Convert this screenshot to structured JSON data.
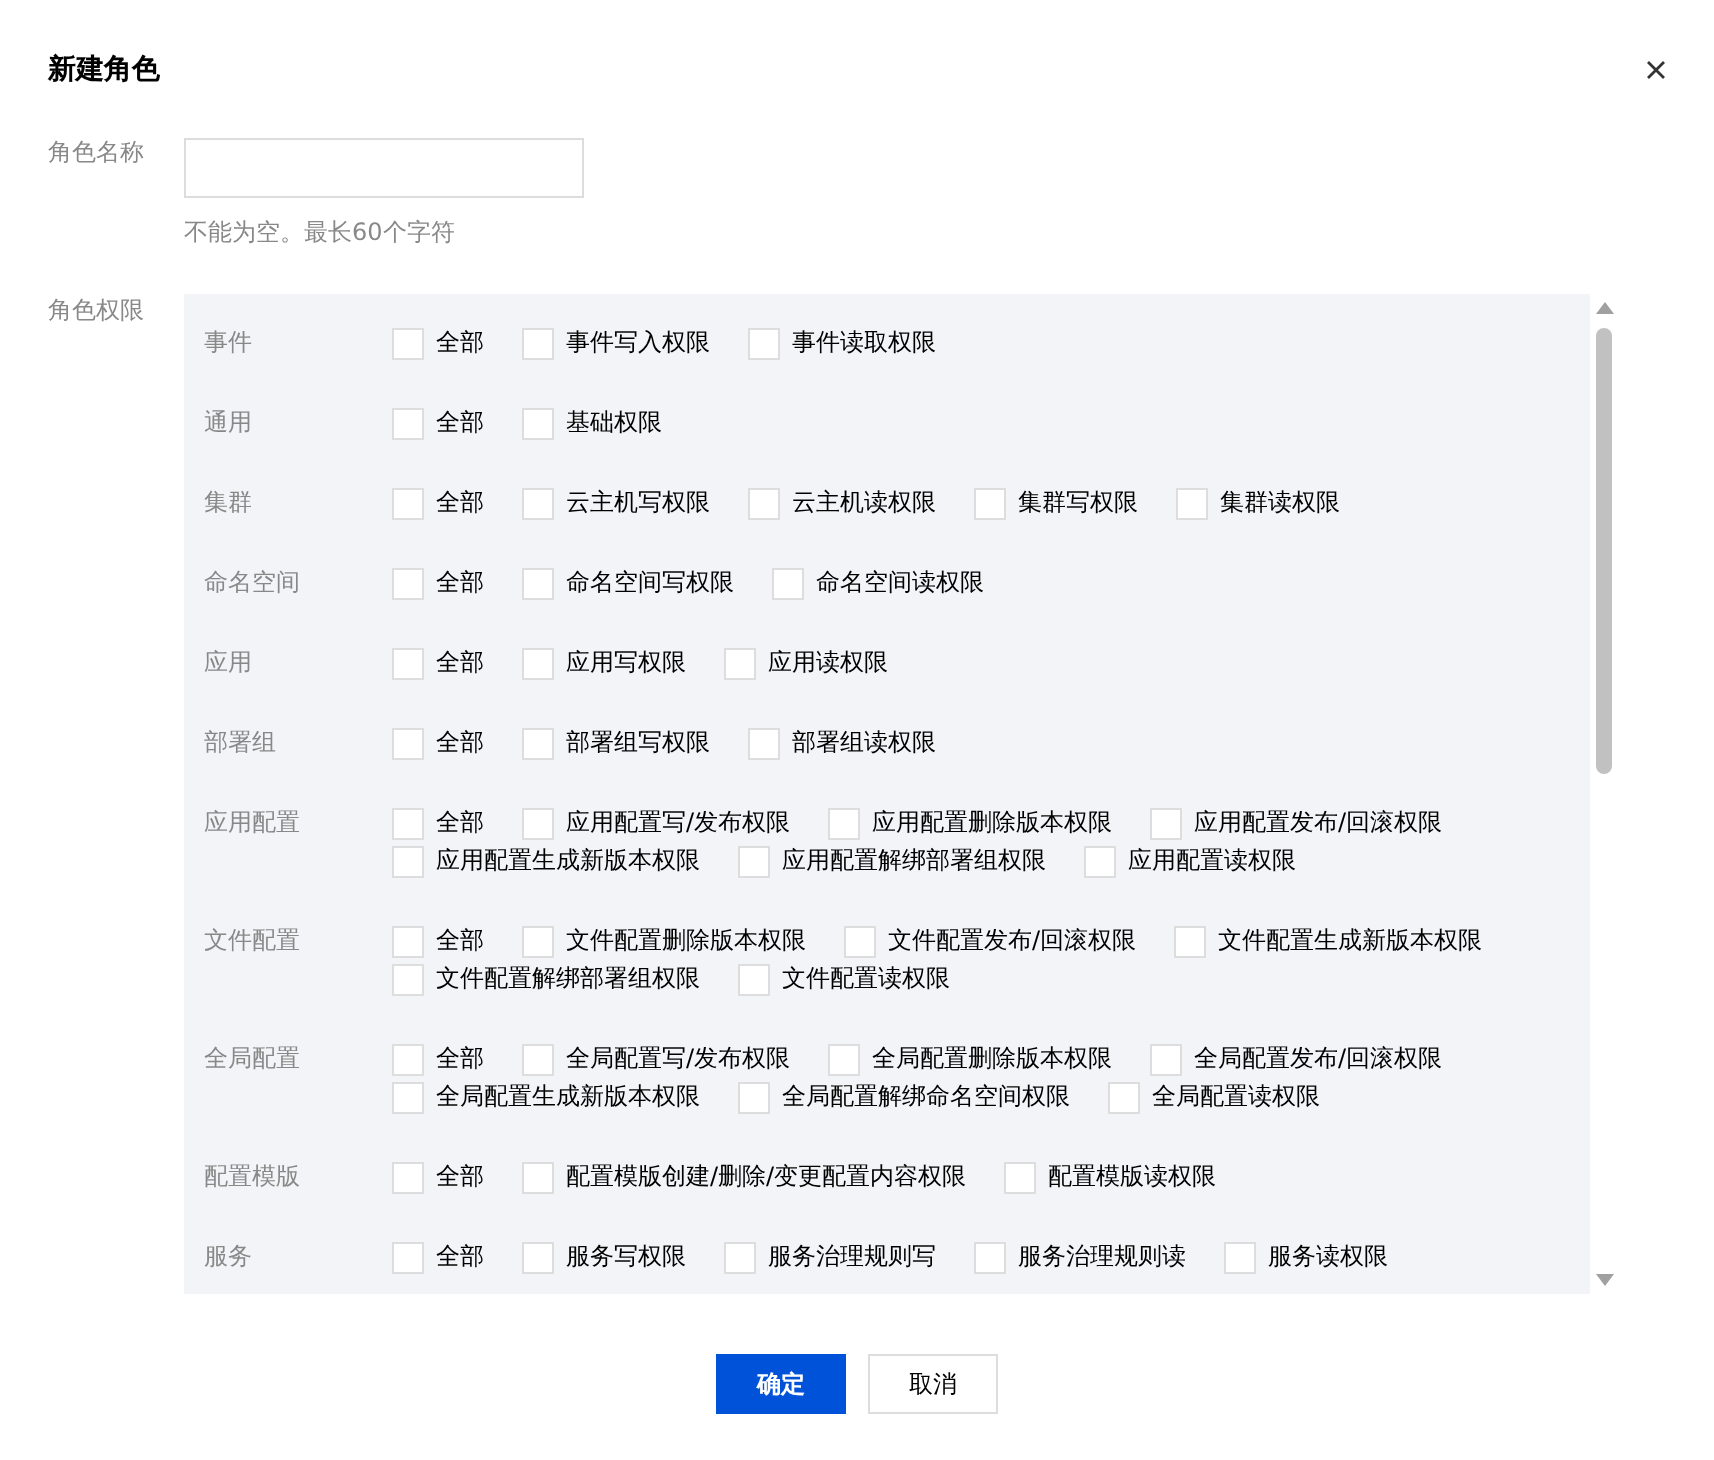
{
  "dialog": {
    "title": "新建角色"
  },
  "name_label": "角色名称",
  "name_hint": "不能为空。最长60个字符",
  "permissions_label": "角色权限",
  "permissions": [
    {
      "category": "事件",
      "options": [
        {
          "label": "全部",
          "checked": false
        },
        {
          "label": "事件写入权限",
          "checked": false
        },
        {
          "label": "事件读取权限",
          "checked": false
        }
      ]
    },
    {
      "category": "通用",
      "options": [
        {
          "label": "全部",
          "checked": false
        },
        {
          "label": "基础权限",
          "checked": false
        }
      ]
    },
    {
      "category": "集群",
      "options": [
        {
          "label": "全部",
          "checked": false
        },
        {
          "label": "云主机写权限",
          "checked": false
        },
        {
          "label": "云主机读权限",
          "checked": false
        },
        {
          "label": "集群写权限",
          "checked": false
        },
        {
          "label": "集群读权限",
          "checked": false
        }
      ]
    },
    {
      "category": "命名空间",
      "options": [
        {
          "label": "全部",
          "checked": false
        },
        {
          "label": "命名空间写权限",
          "checked": false
        },
        {
          "label": "命名空间读权限",
          "checked": false
        }
      ]
    },
    {
      "category": "应用",
      "options": [
        {
          "label": "全部",
          "checked": false
        },
        {
          "label": "应用写权限",
          "checked": false
        },
        {
          "label": "应用读权限",
          "checked": false
        }
      ]
    },
    {
      "category": "部署组",
      "options": [
        {
          "label": "全部",
          "checked": false
        },
        {
          "label": "部署组写权限",
          "checked": false
        },
        {
          "label": "部署组读权限",
          "checked": false
        }
      ]
    },
    {
      "category": "应用配置",
      "options": [
        {
          "label": "全部",
          "checked": false
        },
        {
          "label": "应用配置写/发布权限",
          "checked": false
        },
        {
          "label": "应用配置删除版本权限",
          "checked": false
        },
        {
          "label": "应用配置发布/回滚权限",
          "checked": false
        },
        {
          "label": "应用配置生成新版本权限",
          "checked": false
        },
        {
          "label": "应用配置解绑部署组权限",
          "checked": false
        },
        {
          "label": "应用配置读权限",
          "checked": false
        }
      ]
    },
    {
      "category": "文件配置",
      "options": [
        {
          "label": "全部",
          "checked": false
        },
        {
          "label": "文件配置删除版本权限",
          "checked": false
        },
        {
          "label": "文件配置发布/回滚权限",
          "checked": false
        },
        {
          "label": "文件配置生成新版本权限",
          "checked": false
        },
        {
          "label": "文件配置解绑部署组权限",
          "checked": false
        },
        {
          "label": "文件配置读权限",
          "checked": false
        }
      ]
    },
    {
      "category": "全局配置",
      "options": [
        {
          "label": "全部",
          "checked": false
        },
        {
          "label": "全局配置写/发布权限",
          "checked": false
        },
        {
          "label": "全局配置删除版本权限",
          "checked": false
        },
        {
          "label": "全局配置发布/回滚权限",
          "checked": false
        },
        {
          "label": "全局配置生成新版本权限",
          "checked": false
        },
        {
          "label": "全局配置解绑命名空间权限",
          "checked": false
        },
        {
          "label": "全局配置读权限",
          "checked": false
        }
      ]
    },
    {
      "category": "配置模版",
      "options": [
        {
          "label": "全部",
          "checked": false
        },
        {
          "label": "配置模版创建/删除/变更配置内容权限",
          "checked": false
        },
        {
          "label": "配置模版读权限",
          "checked": false
        }
      ]
    },
    {
      "category": "服务",
      "options": [
        {
          "label": "全部",
          "checked": false
        },
        {
          "label": "服务写权限",
          "checked": false
        },
        {
          "label": "服务治理规则写",
          "checked": false
        },
        {
          "label": "服务治理规则读",
          "checked": false
        },
        {
          "label": "服务读权限",
          "checked": false
        }
      ]
    }
  ],
  "buttons": [
    {
      "label": "确定",
      "kind": "primary"
    },
    {
      "label": "取消",
      "kind": "default"
    }
  ]
}
